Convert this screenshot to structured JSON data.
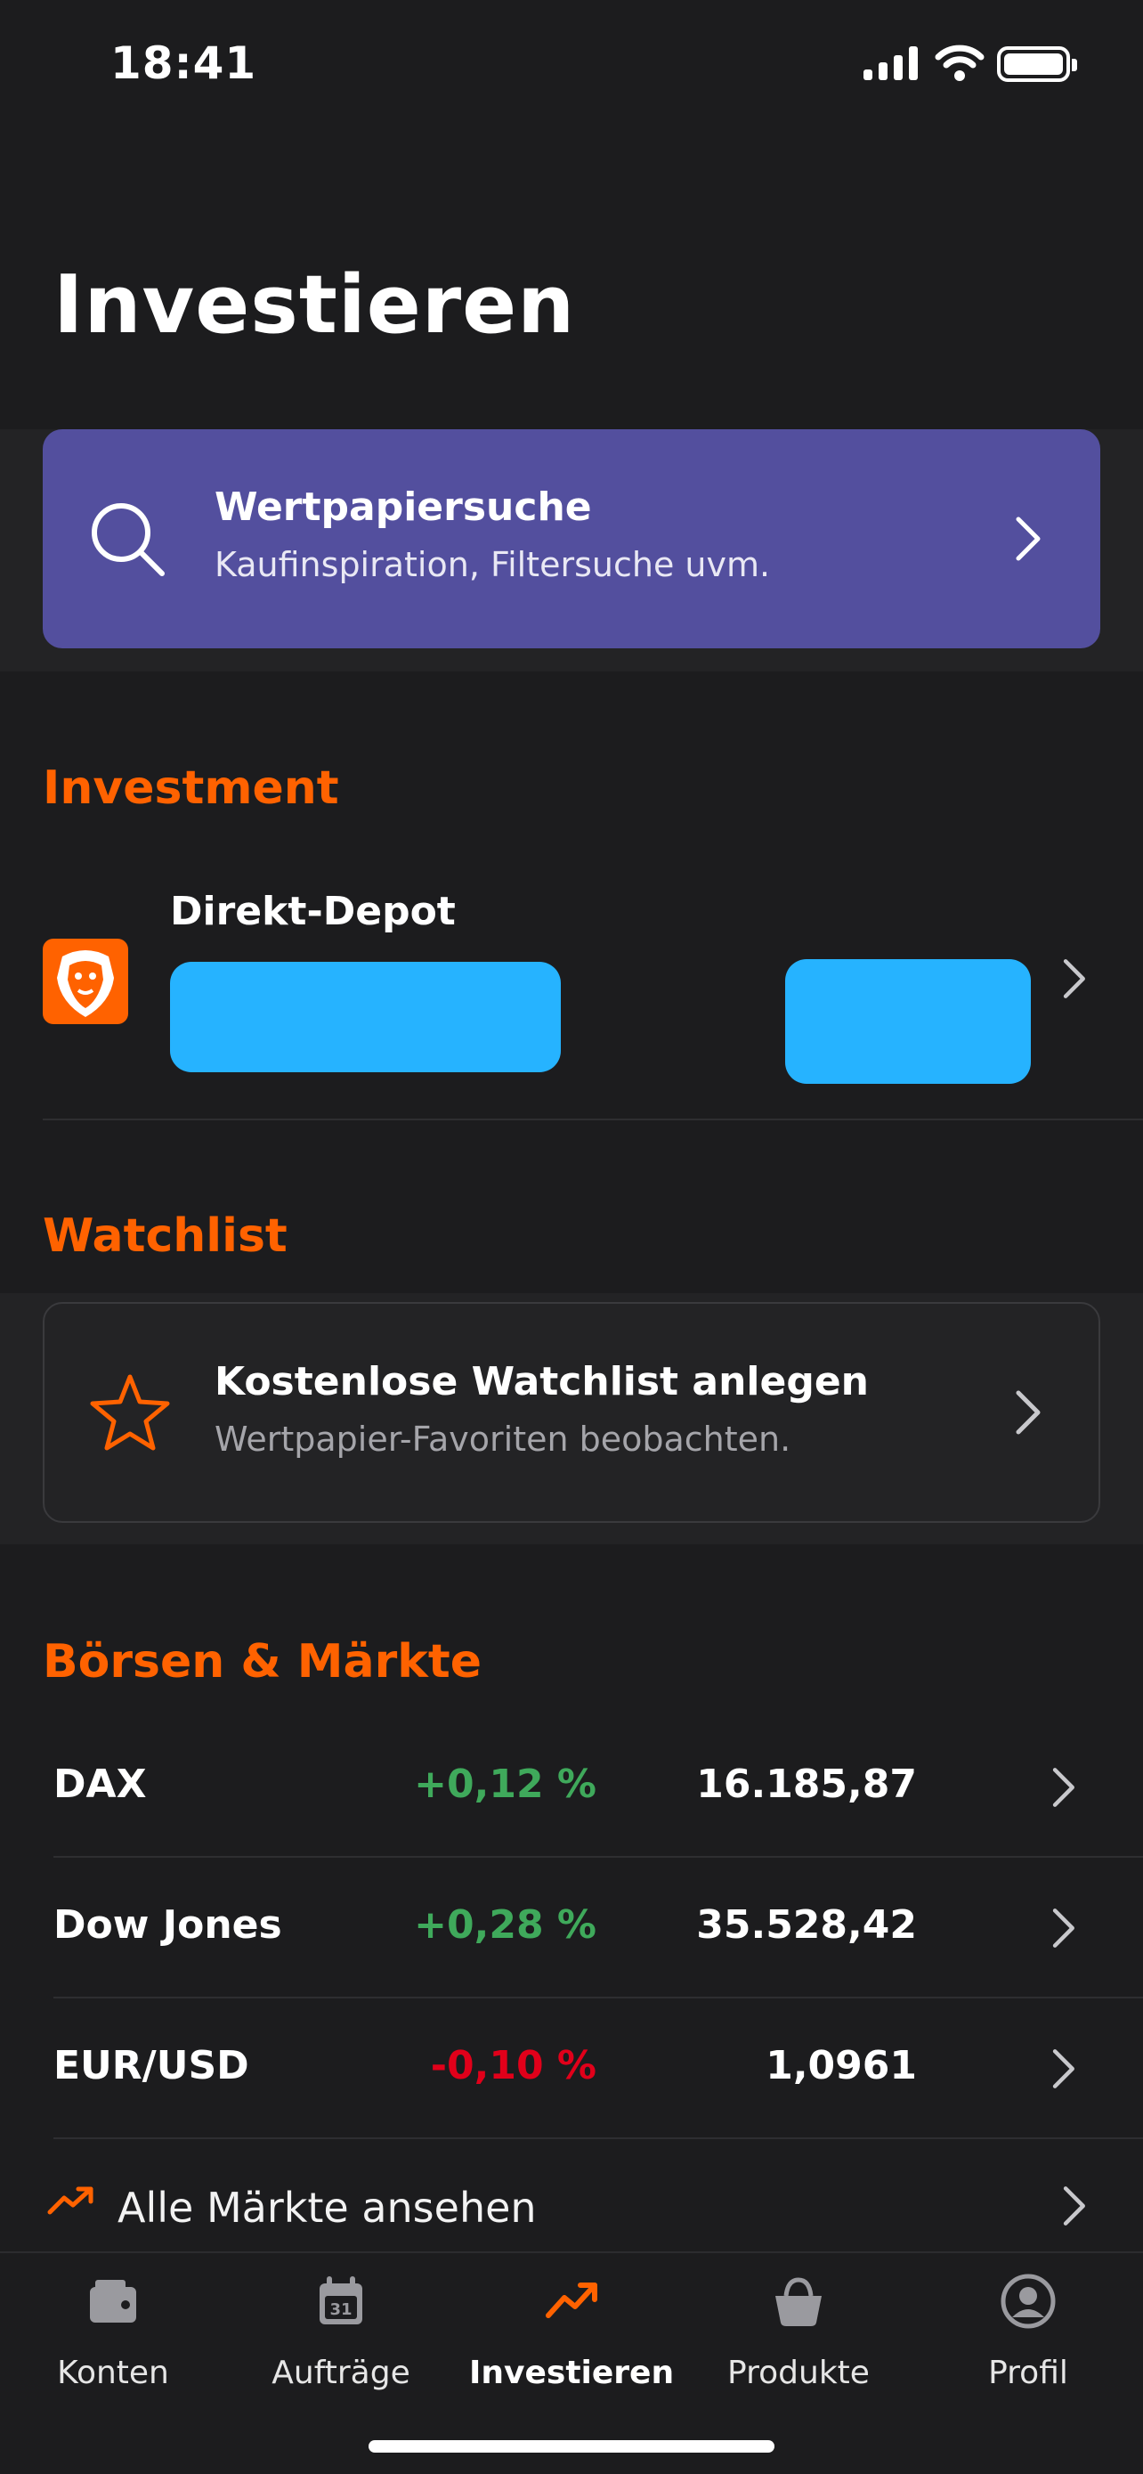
{
  "status_bar": {
    "time": "18:41"
  },
  "header": {
    "title": "Investieren"
  },
  "search_card": {
    "title": "Wertpapiersuche",
    "subtitle": "Kaufinspiration, Filtersuche uvm.",
    "icon": "search-icon"
  },
  "investment": {
    "heading": "Investment",
    "depot_name": "Direkt-Depot"
  },
  "watchlist": {
    "heading": "Watchlist",
    "card_title": "Kostenlose Watchlist anlegen",
    "card_subtitle": "Wertpapier-Favoriten beobachten.",
    "icon": "star-icon"
  },
  "markets": {
    "heading": "Börsen & Märkte",
    "rows": [
      {
        "name": "DAX",
        "change": "+0,12 %",
        "value": "16.185,87",
        "trend": "up"
      },
      {
        "name": "Dow Jones",
        "change": "+0,28 %",
        "value": "35.528,42",
        "trend": "up"
      },
      {
        "name": "EUR/USD",
        "change": "-0,10 %",
        "value": "1,0961",
        "trend": "down"
      }
    ],
    "all_label": "Alle Märkte ansehen"
  },
  "tabs": [
    {
      "label": "Konten",
      "icon": "wallet-icon",
      "active": false
    },
    {
      "label": "Aufträge",
      "icon": "calendar-icon",
      "active": false
    },
    {
      "label": "Investieren",
      "icon": "trending-up-icon",
      "active": true
    },
    {
      "label": "Produkte",
      "icon": "basket-icon",
      "active": false
    },
    {
      "label": "Profil",
      "icon": "profile-icon",
      "active": false
    }
  ],
  "colors": {
    "background": "#1c1c1e",
    "accent": "#ff6200",
    "search_card": "#534f9e",
    "positive": "#3fa95b",
    "negative": "#e1001a",
    "redaction": "#26b3ff"
  }
}
